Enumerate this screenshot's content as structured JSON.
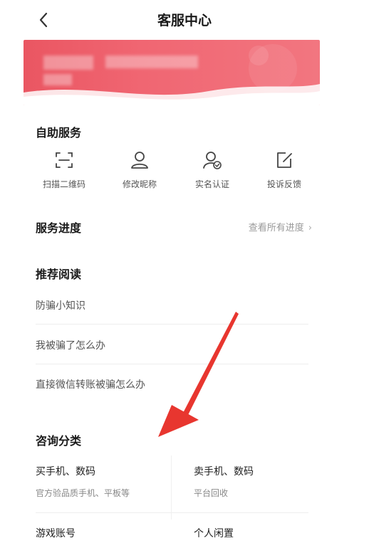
{
  "header": {
    "title": "客服中心"
  },
  "self_service": {
    "title": "自助服务",
    "items": [
      {
        "label": "扫描二维码",
        "icon": "scan-icon"
      },
      {
        "label": "修改昵称",
        "icon": "user-icon"
      },
      {
        "label": "实名认证",
        "icon": "verified-user-icon"
      },
      {
        "label": "投诉反馈",
        "icon": "edit-icon"
      }
    ]
  },
  "progress": {
    "title": "服务进度",
    "link": "查看所有进度"
  },
  "reading": {
    "title": "推荐阅读",
    "items": [
      "防骗小知识",
      "我被骗了怎么办",
      "直接微信转账被骗怎么办"
    ]
  },
  "consult": {
    "title": "咨询分类",
    "items": [
      {
        "name": "买手机、数码",
        "desc": "官方验品质手机、平板等"
      },
      {
        "name": "卖手机、数码",
        "desc": "平台回收"
      },
      {
        "name": "游戏账号",
        "desc": ""
      },
      {
        "name": "个人闲置",
        "desc": ""
      }
    ]
  },
  "colors": {
    "banner": "#ef5f6b",
    "arrow": "#e8362f"
  }
}
